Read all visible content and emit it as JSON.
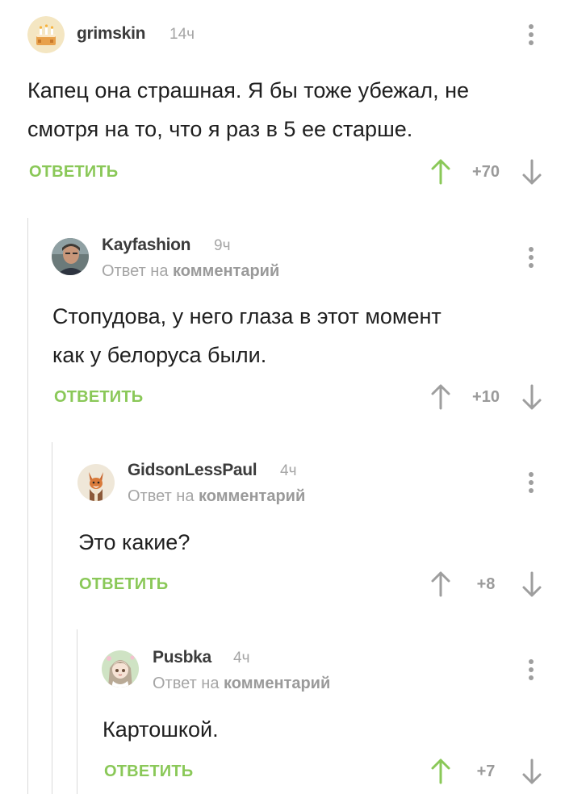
{
  "comments": [
    {
      "username": "grimskin",
      "time": "14ч",
      "reply_prefix": "",
      "reply_target": "",
      "text_lines": [
        "Капец она страшная. Я бы тоже убежал, не",
        "смотря на то, что я раз в 5 ее старше."
      ],
      "reply_label": "ОТВЕТИТЬ",
      "rating": "+70",
      "upvoted": true,
      "avatar": "cake-avatar"
    },
    {
      "username": "Kayfashion",
      "time": "9ч",
      "reply_prefix": "Ответ на",
      "reply_target": "комментарий",
      "text_lines": [
        "Стопудова, у него глаза в этот момент",
        "как у белоруса были."
      ],
      "reply_label": "ОТВЕТИТЬ",
      "rating": "+10",
      "upvoted": false,
      "avatar": "man-photo-avatar"
    },
    {
      "username": "GidsonLessPaul",
      "time": "4ч",
      "reply_prefix": "Ответ на",
      "reply_target": "комментарий",
      "text_lines": [
        "Это какие?"
      ],
      "reply_label": "ОТВЕТИТЬ",
      "rating": "+8",
      "upvoted": false,
      "avatar": "fox-drawing-avatar"
    },
    {
      "username": "Pusbka",
      "time": "4ч",
      "reply_prefix": "Ответ на",
      "reply_target": "комментарий",
      "text_lines": [
        "Картошкой."
      ],
      "reply_label": "ОТВЕТИТЬ",
      "rating": "+7",
      "upvoted": true,
      "avatar": "anime-girl-avatar"
    }
  ],
  "colors": {
    "accent_green": "#8ac858",
    "text": "#1f1f1f",
    "muted": "#a5a5a5",
    "icon_gray": "#9e9e9e"
  },
  "icons": {
    "more": "more-vertical-icon",
    "upvote": "arrow-up-icon",
    "downvote": "arrow-down-icon"
  }
}
